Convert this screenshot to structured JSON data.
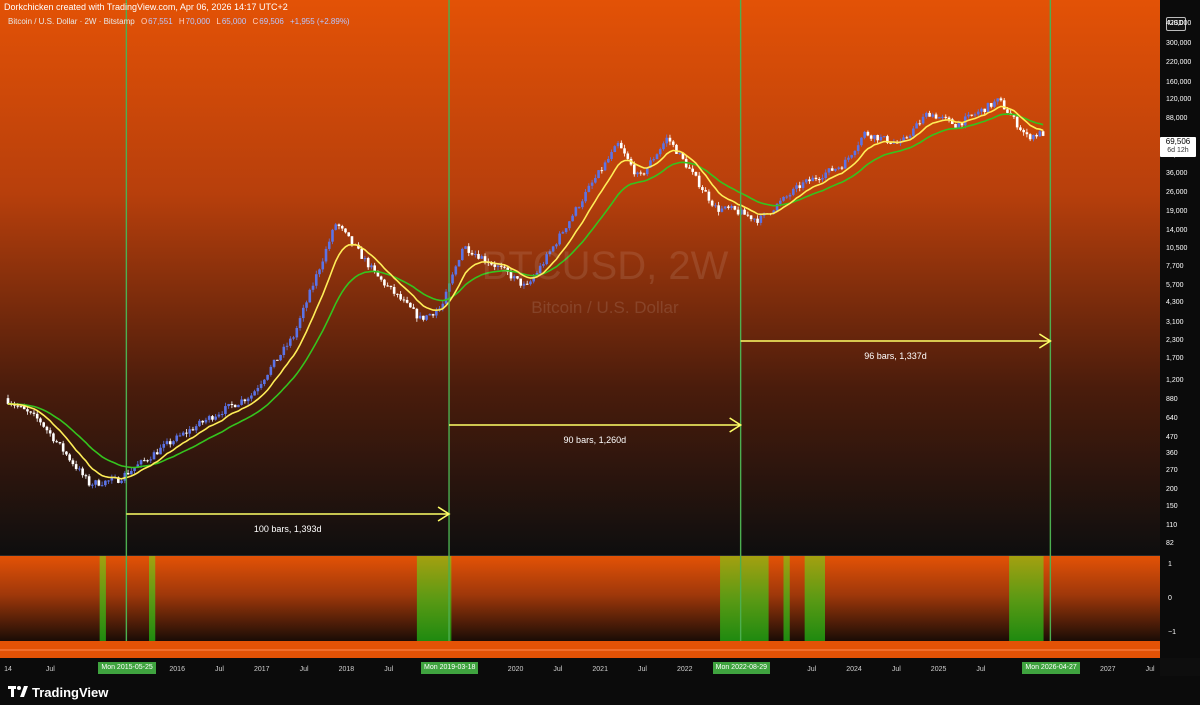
{
  "header": {
    "credit": "Dorkchicken created with TradingView.com, Apr 06, 2026 14:17 UTC+2",
    "symbol": "Bitcoin / U.S. Dollar · 2W · Bitstamp",
    "o_value": "67,551",
    "h_value": "70,000",
    "l_value": "65,000",
    "c_value": "69,506",
    "change": "+1,955 (+2.89%)"
  },
  "watermark": {
    "ticker": "BTCUSD, 2W",
    "description": "Bitcoin / U.S. Dollar"
  },
  "price_axis": {
    "currency": "USD",
    "labels": [
      "420,000",
      "300,000",
      "220,000",
      "160,000",
      "120,000",
      "88,000",
      "48,000",
      "36,000",
      "26,000",
      "19,000",
      "14,000",
      "10,500",
      "7,700",
      "5,700",
      "4,300",
      "3,100",
      "2,300",
      "1,700",
      "1,200",
      "880",
      "640",
      "470",
      "360",
      "270",
      "200",
      "150",
      "110",
      "82"
    ],
    "last_price": "69,506",
    "countdown": "6d 12h"
  },
  "indicator_axis": {
    "labels": [
      "1",
      "0",
      "−1"
    ]
  },
  "time_axis": {
    "labels": [
      "14",
      "Jul",
      "2016",
      "Jul",
      "2017",
      "Jul",
      "2018",
      "Jul",
      "2020",
      "Jul",
      "2021",
      "Jul",
      "2022",
      "Jul",
      "2024",
      "Jul",
      "2025",
      "Jul",
      "2027",
      "Jul"
    ],
    "markers": [
      "Mon 2015-05-25",
      "Mon 2019-03-18",
      "Mon 2022-08-29",
      "Mon 2026-04-27"
    ]
  },
  "measurements": [
    "100 bars, 1,393d",
    "90 bars, 1,260d",
    "96 bars, 1,337d"
  ],
  "branding": "TradingView",
  "colors": {
    "candle_up": "#5b73e6",
    "candle_down": "#ffffff",
    "ma_fast": "#ffee58",
    "ma_slow": "#35c41e",
    "cycle_line": "#4caf50",
    "arrow": "#ffff66",
    "bg_top": "#e35206",
    "bg_bottom": "#0e0e0e"
  },
  "chart_data": {
    "type": "candlestick",
    "scale": "log",
    "ylim": [
      82,
      420000
    ],
    "x_range": [
      "2014-01",
      "2027-12"
    ],
    "price_path": [
      [
        "2014-01",
        900
      ],
      [
        "2014-06",
        620
      ],
      [
        "2015-01",
        220
      ],
      [
        "2015-05",
        235
      ],
      [
        "2015-12",
        420
      ],
      [
        "2016-06",
        650
      ],
      [
        "2016-12",
        950
      ],
      [
        "2017-06",
        2500
      ],
      [
        "2017-12",
        16000
      ],
      [
        "2018-06",
        6500
      ],
      [
        "2018-12",
        3300
      ],
      [
        "2019-03",
        4000
      ],
      [
        "2019-06",
        11000
      ],
      [
        "2019-12",
        7200
      ],
      [
        "2020-03",
        5500
      ],
      [
        "2020-06",
        9300
      ],
      [
        "2020-12",
        29000
      ],
      [
        "2021-04",
        58000
      ],
      [
        "2021-07",
        33000
      ],
      [
        "2021-11",
        65000
      ],
      [
        "2022-06",
        20000
      ],
      [
        "2022-08",
        20000
      ],
      [
        "2022-12",
        16800
      ],
      [
        "2023-06",
        30000
      ],
      [
        "2023-12",
        42000
      ],
      [
        "2024-03",
        70000
      ],
      [
        "2024-08",
        58000
      ],
      [
        "2024-12",
        98000
      ],
      [
        "2025-04",
        80000
      ],
      [
        "2025-10",
        120000
      ],
      [
        "2026-02",
        66000
      ],
      [
        "2026-04",
        69506
      ]
    ],
    "cycle_markers": [
      "2015-05-25",
      "2019-03-18",
      "2022-08-29",
      "2026-04-27"
    ],
    "measurements": [
      {
        "from": "2015-05-25",
        "to": "2019-03-18",
        "label": "100 bars, 1,393d"
      },
      {
        "from": "2019-03-18",
        "to": "2022-08-29",
        "label": "90 bars, 1,260d"
      },
      {
        "from": "2022-08-29",
        "to": "2026-04-27",
        "label": "96 bars, 1,337d"
      }
    ],
    "indicator_signals": [
      [
        "2015-02",
        "2015-02"
      ],
      [
        "2015-09",
        "2015-09"
      ],
      [
        "2018-11",
        "2019-03"
      ],
      [
        "2022-06",
        "2022-12"
      ],
      [
        "2023-03",
        "2023-03"
      ],
      [
        "2023-06",
        "2023-08"
      ],
      [
        "2025-11",
        "2026-03"
      ]
    ]
  }
}
